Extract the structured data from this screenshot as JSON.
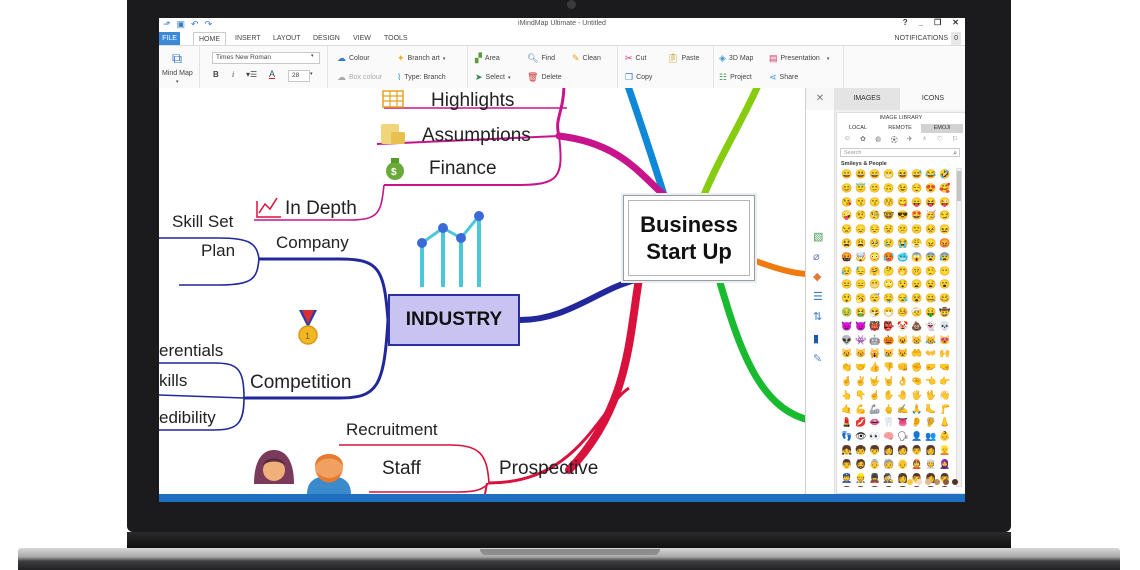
{
  "app": {
    "title": "iMindMap Ultimate - Untitled",
    "window_controls": [
      "?",
      "_",
      "❐",
      "✕"
    ]
  },
  "tabs": [
    {
      "label": "FILE"
    },
    {
      "label": "HOME"
    },
    {
      "label": "INSERT"
    },
    {
      "label": "LAYOUT"
    },
    {
      "label": "DESIGN"
    },
    {
      "label": "VIEW"
    },
    {
      "label": "TOOLS"
    }
  ],
  "notifications": {
    "label": "NOTIFICATIONS",
    "count": "0"
  },
  "ribbon": {
    "mindmap_label": "Mind Map",
    "font_name": "Times New Roman",
    "font_size": "28",
    "bold": "B",
    "italic": "i",
    "colour": "Colour",
    "box_colour": "Box colour",
    "branch_art": "Branch art",
    "type_branch": "Type: Branch",
    "area": "Area",
    "select": "Select",
    "find": "Find",
    "delete": "Delete",
    "clean": "Clean",
    "cut": "Cut",
    "paste": "Paste",
    "copy": "Copy",
    "map3d": "3D Map",
    "project": "Project",
    "presentation": "Presentation",
    "share": "Share"
  },
  "mindmap": {
    "central": "Business Start Up",
    "industry": "INDUSTRY",
    "branches": {
      "highlights": "Highlights",
      "assumptions": "Assumptions",
      "finance": "Finance",
      "in_depth": "In Depth",
      "skill_set": "Skill Set",
      "plan": "Plan",
      "company": "Company",
      "differentials": "erentials",
      "skills": "kills",
      "credibility": "edibility",
      "competition": "Competition",
      "recruitment": "Recruitment",
      "staff": "Staff",
      "prospective": "Prospective"
    },
    "colors": {
      "magenta": "#c8148c",
      "navy": "#22279b",
      "red": "#d8123c",
      "blue": "#1088d8",
      "lime": "#88cc10",
      "green": "#18bb30",
      "orange": "#f07a10"
    }
  },
  "panel": {
    "tabs": [
      "IMAGES",
      "ICONS"
    ],
    "library_title": "IMAGE LIBRARY",
    "subtabs": [
      "LOCAL",
      "REMOTE",
      "EMOJI"
    ],
    "search_placeholder": "Search",
    "section": "Smileys & People",
    "emoji": [
      "😀",
      "😃",
      "😄",
      "😁",
      "😆",
      "😅",
      "😂",
      "🤣",
      "😊",
      "😇",
      "🙂",
      "🙃",
      "😉",
      "😌",
      "😍",
      "🥰",
      "😘",
      "😗",
      "😙",
      "😚",
      "😋",
      "😛",
      "😝",
      "😜",
      "🤪",
      "🤨",
      "🧐",
      "🤓",
      "😎",
      "🤩",
      "🥳",
      "😏",
      "😒",
      "😞",
      "😔",
      "😟",
      "😕",
      "🙁",
      "😣",
      "😖",
      "😫",
      "😩",
      "🥺",
      "😢",
      "😭",
      "😤",
      "😠",
      "😡",
      "🤬",
      "🤯",
      "😳",
      "🥵",
      "🥶",
      "😱",
      "😨",
      "😰",
      "😥",
      "😓",
      "🤗",
      "🤔",
      "🤭",
      "🤫",
      "🤥",
      "😶",
      "😐",
      "😑",
      "😬",
      "🙄",
      "😯",
      "😦",
      "😧",
      "😮",
      "😲",
      "🥱",
      "😴",
      "🤤",
      "😪",
      "😵",
      "🤐",
      "🥴",
      "🤢",
      "🤮",
      "🤧",
      "😷",
      "🤒",
      "🤕",
      "🤑",
      "🤠",
      "😈",
      "👿",
      "👹",
      "👺",
      "🤡",
      "💩",
      "👻",
      "💀",
      "👽",
      "👾",
      "🤖",
      "🎃",
      "😺",
      "😸",
      "😹",
      "😻",
      "😼",
      "😽",
      "🙀",
      "😿",
      "😾",
      "🤲",
      "👐",
      "🙌",
      "👏",
      "🤝",
      "👍",
      "👎",
      "👊",
      "✊",
      "🤛",
      "🤜",
      "🤞",
      "✌",
      "🤟",
      "🤘",
      "👌",
      "🤏",
      "👈",
      "👉",
      "👆",
      "👇",
      "☝",
      "✋",
      "🤚",
      "🖐",
      "🖖",
      "👋",
      "🤙",
      "💪",
      "🦾",
      "🖕",
      "✍",
      "🙏",
      "🦶",
      "🦵",
      "💄",
      "💋",
      "👄",
      "🦷",
      "👅",
      "👂",
      "🦻",
      "👃",
      "👣",
      "👁",
      "👀",
      "🧠",
      "🗣",
      "👤",
      "👥",
      "👶",
      "👧",
      "🧒",
      "👦",
      "👩",
      "🧑",
      "👨",
      "👩",
      "👱",
      "👨",
      "🧔",
      "👵",
      "🧓",
      "👴",
      "👲",
      "👳",
      "🧕",
      "👮",
      "👷",
      "💂",
      "🕵",
      "👩",
      "👨",
      "👩",
      "👨",
      "👩",
      "👨",
      "👩",
      "👨",
      "👩",
      "👨",
      "👩",
      "👨",
      "👩",
      "👨",
      "👩",
      "👨",
      "👩",
      "👨",
      "👩",
      "👨",
      "👩",
      "👨",
      "👩",
      "👨",
      "👩",
      "👨",
      "👸",
      "🤴",
      "🦸",
      "🦹",
      "🤶",
      "🎅",
      "🧙",
      "🧝",
      "🧛",
      "🧟",
      "🧞",
      "🧜",
      "🧚",
      "👼",
      "🤰",
      "🤱",
      "🙇",
      "💁",
      "🙅",
      "🙆",
      "🙋",
      "🧏",
      "🤦",
      "🤷",
      "🙎",
      "🙍",
      "💇",
      "💆"
    ],
    "skin_tones": [
      "#f9c93a",
      "#f8dcc0",
      "#e2b993",
      "#c58d5f",
      "#8d5b38",
      "#4e3426"
    ]
  }
}
